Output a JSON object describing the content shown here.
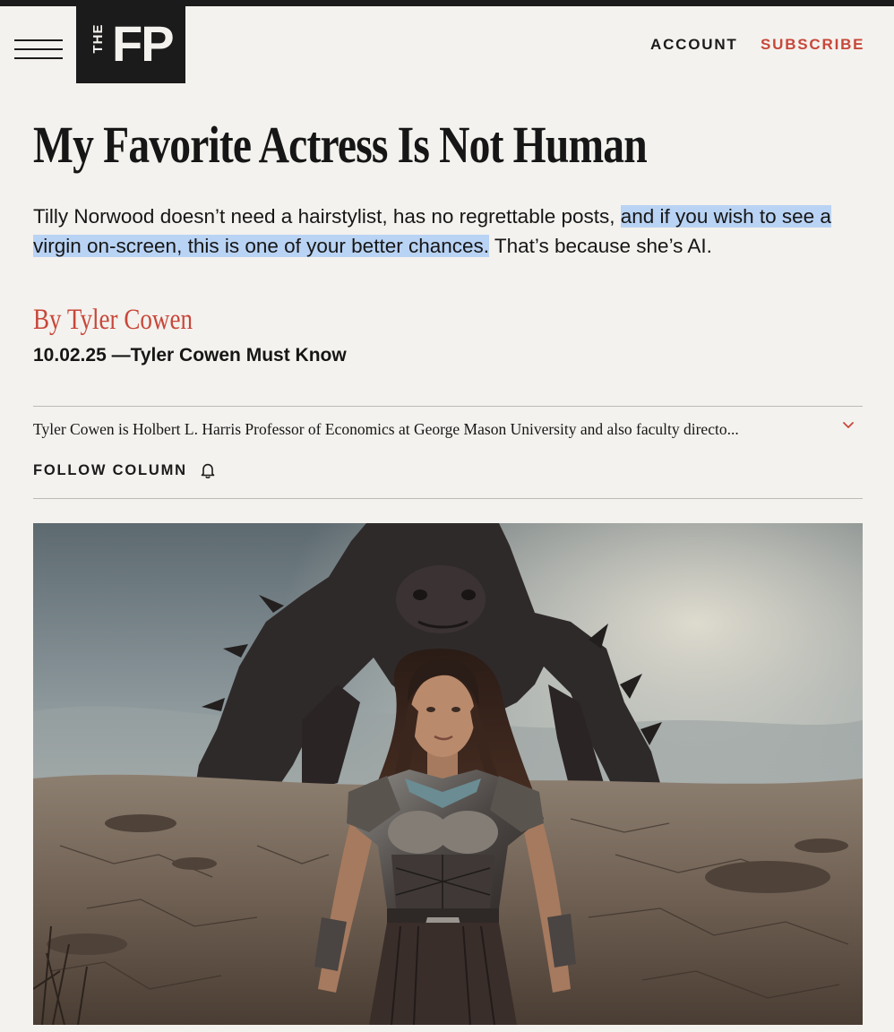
{
  "header": {
    "logo_the": "THE",
    "logo_fp": "FP",
    "account": "ACCOUNT",
    "subscribe": "SUBSCRIBE"
  },
  "article": {
    "headline": "My Favorite Actress Is Not Human",
    "dek_part1": "Tilly Norwood doesn’t need a hairstylist, has no regrettable posts, ",
    "dek_highlighted": "and if you wish to see a virgin on-screen, this is one of your better chances.",
    "dek_part2": " That’s because she’s AI.",
    "byline": "By Tyler Cowen",
    "dateline": "10.02.25 —Tyler Cowen Must Know",
    "author_bio": "Tyler Cowen is Holbert L. Harris Professor of Economics at George Mason University and also faculty directo...",
    "follow_label": "FOLLOW COLUMN"
  },
  "colors": {
    "background": "#f4f2ee",
    "accent_red": "#c8473a",
    "ink": "#161616",
    "highlight": "#b9d3f4",
    "rule": "#bdbab4"
  },
  "icons": {
    "menu": "hamburger-menu-icon",
    "bio_toggle": "chevron-down-icon",
    "follow": "bell-icon"
  }
}
